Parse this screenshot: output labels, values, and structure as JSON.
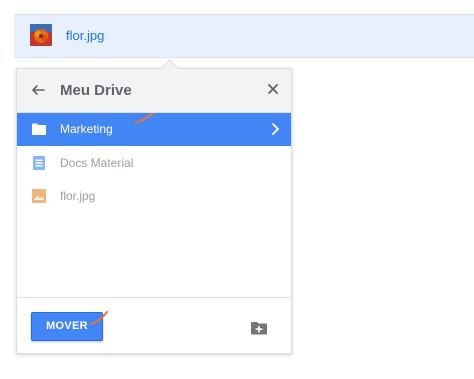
{
  "selected_file": {
    "name": "flor.jpg",
    "thumbnail_icon": "flower-photo-thumbnail"
  },
  "dialog": {
    "title": "Meu Drive",
    "back_icon": "arrow-left-icon",
    "close_icon": "close-icon",
    "items": [
      {
        "label": "Marketing",
        "icon": "folder-icon",
        "selected": true,
        "has_children": true
      },
      {
        "label": "Docs Material",
        "icon": "docs-icon",
        "selected": false
      },
      {
        "label": "flor.jpg",
        "icon": "image-icon",
        "selected": false
      }
    ],
    "move_button_label": "MOVER",
    "new_folder_icon": "new-folder-icon"
  },
  "colors": {
    "accent": "#4285f4",
    "selected_row_bg": "#e8f0fe",
    "header_bg": "#f1f3f4",
    "annotation": "#e8743b"
  }
}
